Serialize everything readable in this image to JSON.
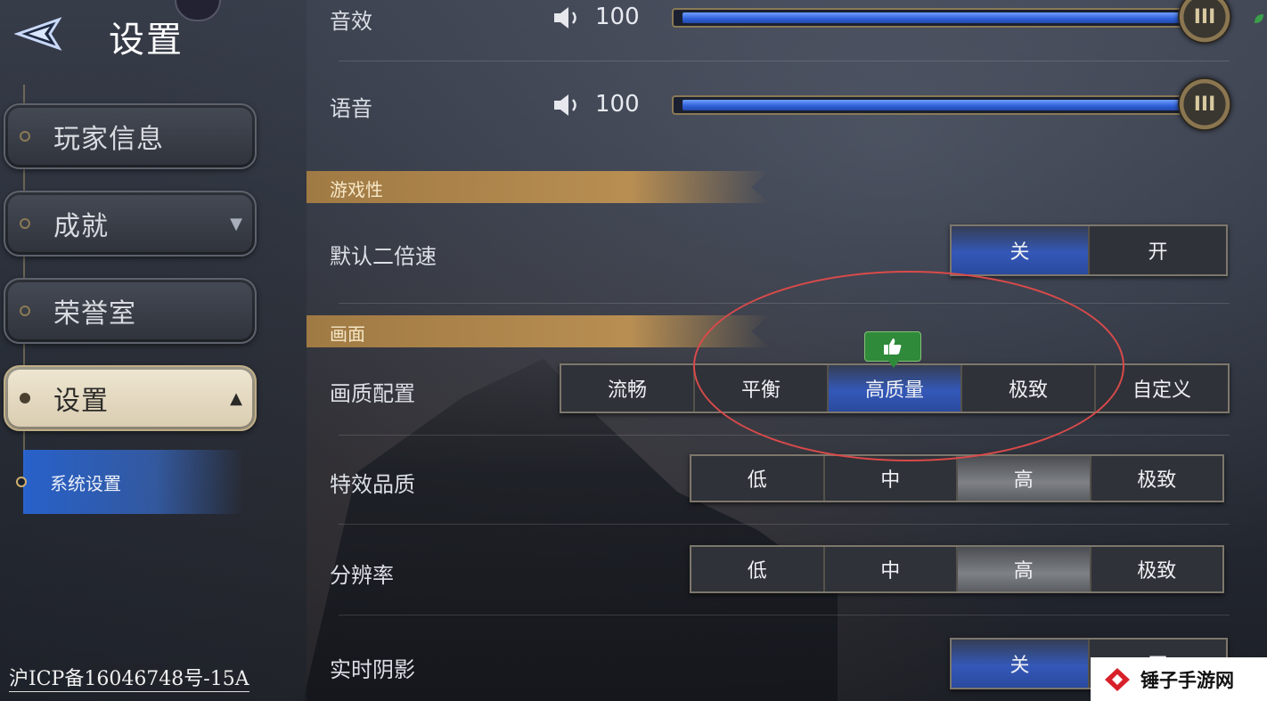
{
  "header": {
    "title": "设置"
  },
  "sidebar": {
    "items": [
      {
        "label": "玩家信息"
      },
      {
        "label": "成就",
        "arrow": "▼"
      },
      {
        "label": "荣誉室"
      },
      {
        "label": "设置",
        "arrow": "▲"
      }
    ],
    "sub_item": {
      "label": "系统设置"
    }
  },
  "footer": {
    "icp": "沪ICP备16046748号-15A"
  },
  "audio": {
    "sfx": {
      "label": "音效",
      "value": "100",
      "level": 1.0
    },
    "voice": {
      "label": "语音",
      "value": "100",
      "level": 1.0
    }
  },
  "sections": {
    "gameplay": {
      "label": "游戏性"
    },
    "graphics": {
      "label": "画面"
    }
  },
  "settings": {
    "double_speed": {
      "label": "默认二倍速",
      "options": [
        "关",
        "开"
      ],
      "selected": "关"
    },
    "quality_preset": {
      "label": "画质配置",
      "options": [
        "流畅",
        "平衡",
        "高质量",
        "极致",
        "自定义"
      ],
      "selected": "高质量",
      "recommended": "高质量"
    },
    "effects": {
      "label": "特效品质",
      "options": [
        "低",
        "中",
        "高",
        "极致"
      ],
      "selected": "高"
    },
    "resolution": {
      "label": "分辨率",
      "options": [
        "低",
        "中",
        "高",
        "极致"
      ],
      "selected": "高"
    },
    "shadows": {
      "label": "实时阴影",
      "options": [
        "关",
        "开"
      ],
      "selected": "关"
    }
  },
  "knob_glyph": "III",
  "watermark": {
    "text": "锤子手游网"
  },
  "colors": {
    "accent_blue": "#3458b8",
    "section_gold": "#b88e52",
    "annotation_red": "#d94a4a"
  }
}
